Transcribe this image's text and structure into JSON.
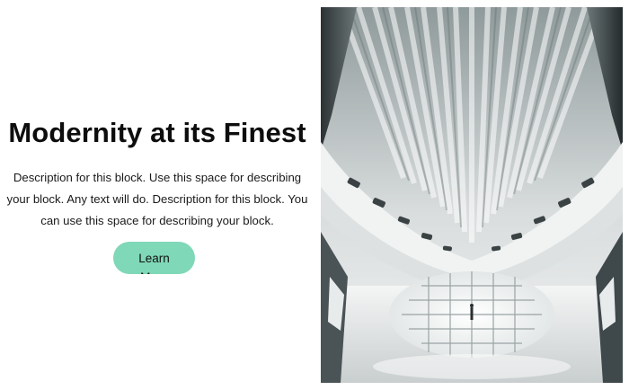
{
  "hero": {
    "title": "Modernity at its Finest",
    "description": "Description for this block. Use this space for describing your block. Any text will do. Description for this block. You can use this space for describing your block.",
    "button_label": "Learn More"
  },
  "image": {
    "subject": "architecture-interior"
  },
  "colors": {
    "accent": "#7fd8b7",
    "text": "#111111",
    "background": "#ffffff"
  }
}
